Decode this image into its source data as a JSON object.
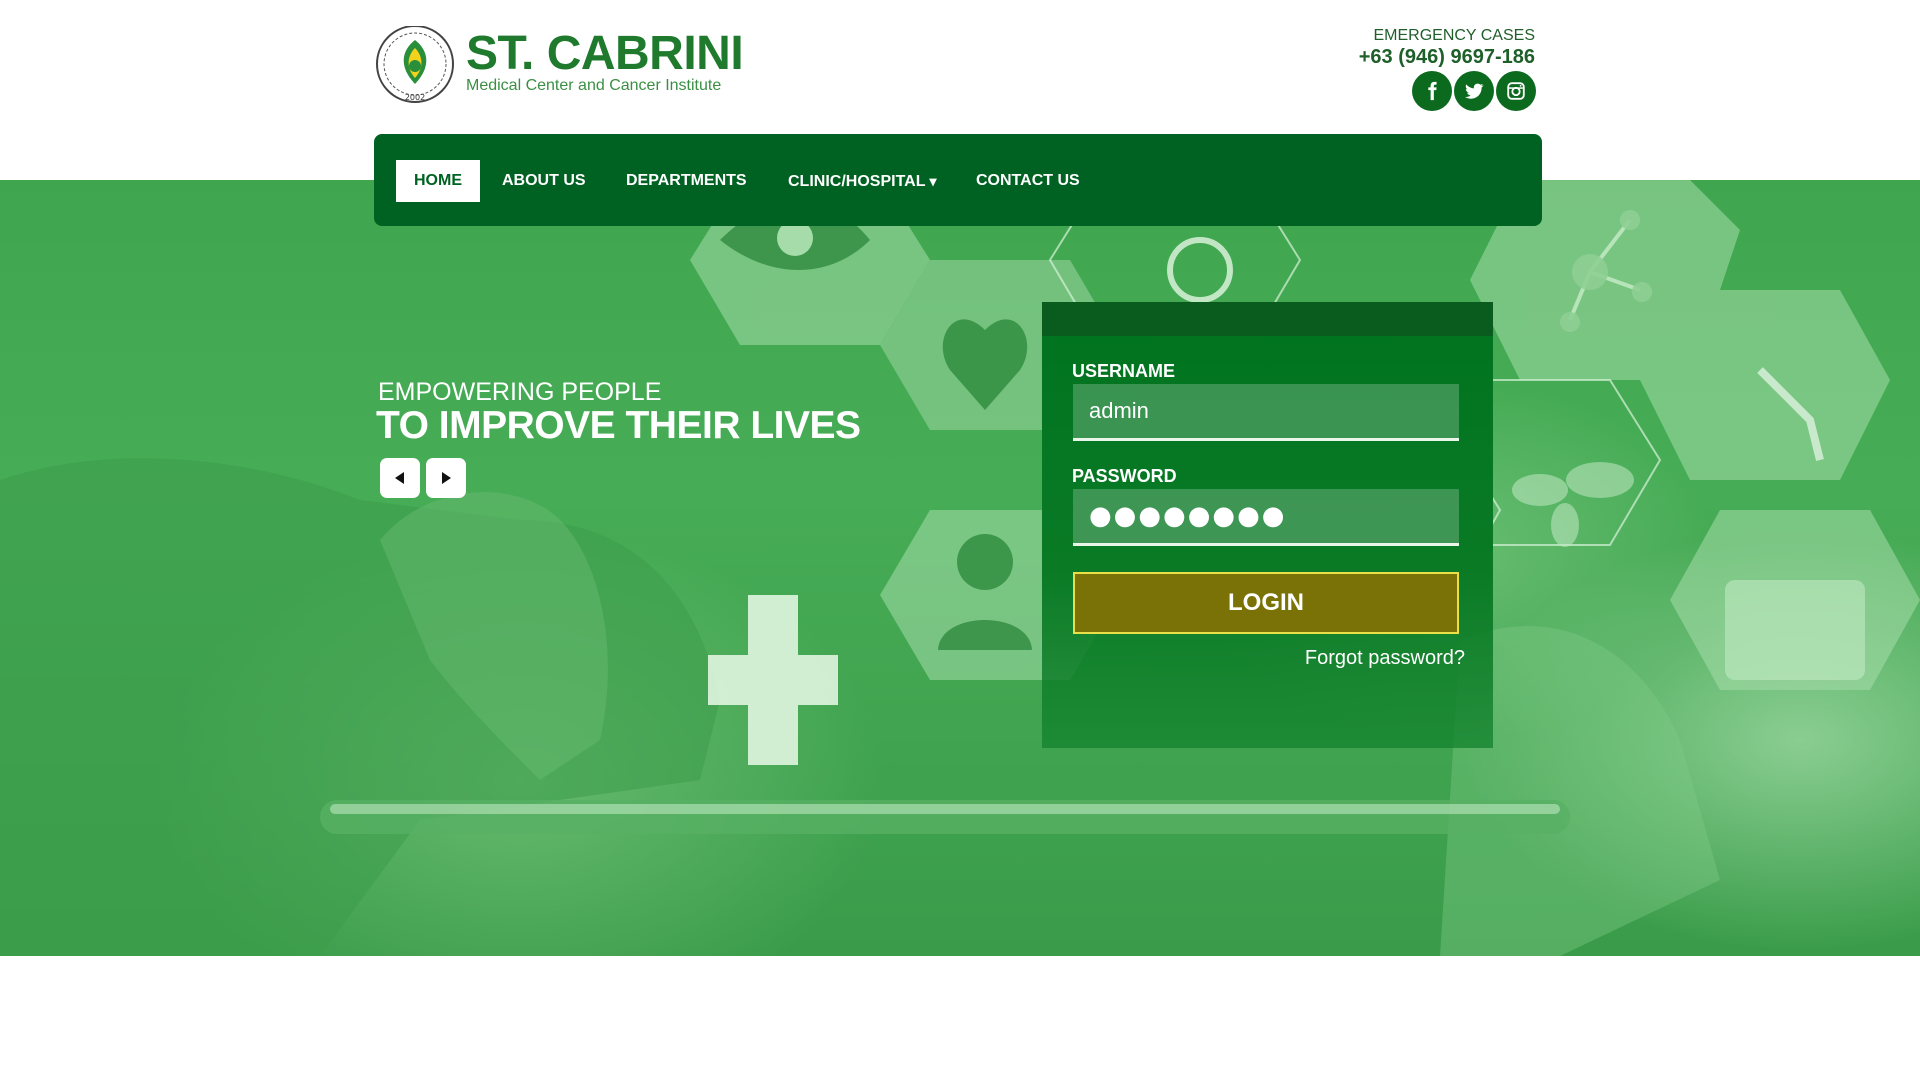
{
  "header": {
    "logo_icon": "hospital-seal-logo",
    "brand_name": "ST. CABRINI",
    "brand_subtitle": "Medical Center and Cancer Institute",
    "emergency_label": "EMERGENCY CASES",
    "emergency_phone": "+63 (946) 9697-186",
    "social": [
      {
        "icon": "facebook-icon"
      },
      {
        "icon": "twitter-icon"
      },
      {
        "icon": "instagram-icon"
      }
    ]
  },
  "nav": {
    "items": [
      {
        "label": "HOME",
        "active": true
      },
      {
        "label": "ABOUT US"
      },
      {
        "label": "DEPARTMENTS"
      },
      {
        "label": "CLINIC/HOSPITAL",
        "caret": "▾"
      },
      {
        "label": "CONTACT US"
      }
    ]
  },
  "hero": {
    "tagline_small": "EMPOWERING PEOPLE",
    "tagline_big": "TO IMPROVE THEIR LIVES",
    "prev_icon": "triangle-left-icon",
    "next_icon": "triangle-right-icon"
  },
  "login": {
    "username_label": "USERNAME",
    "username_value": "admin",
    "password_label": "PASSWORD",
    "password_value": "●●●●●●●●",
    "login_button": "LOGIN",
    "forgot_link": "Forgot password?"
  },
  "colors": {
    "brand_green": "#006222",
    "logo_text_green": "#1f7a2e",
    "login_button": "#7a7206",
    "login_button_border": "#e8e046"
  }
}
